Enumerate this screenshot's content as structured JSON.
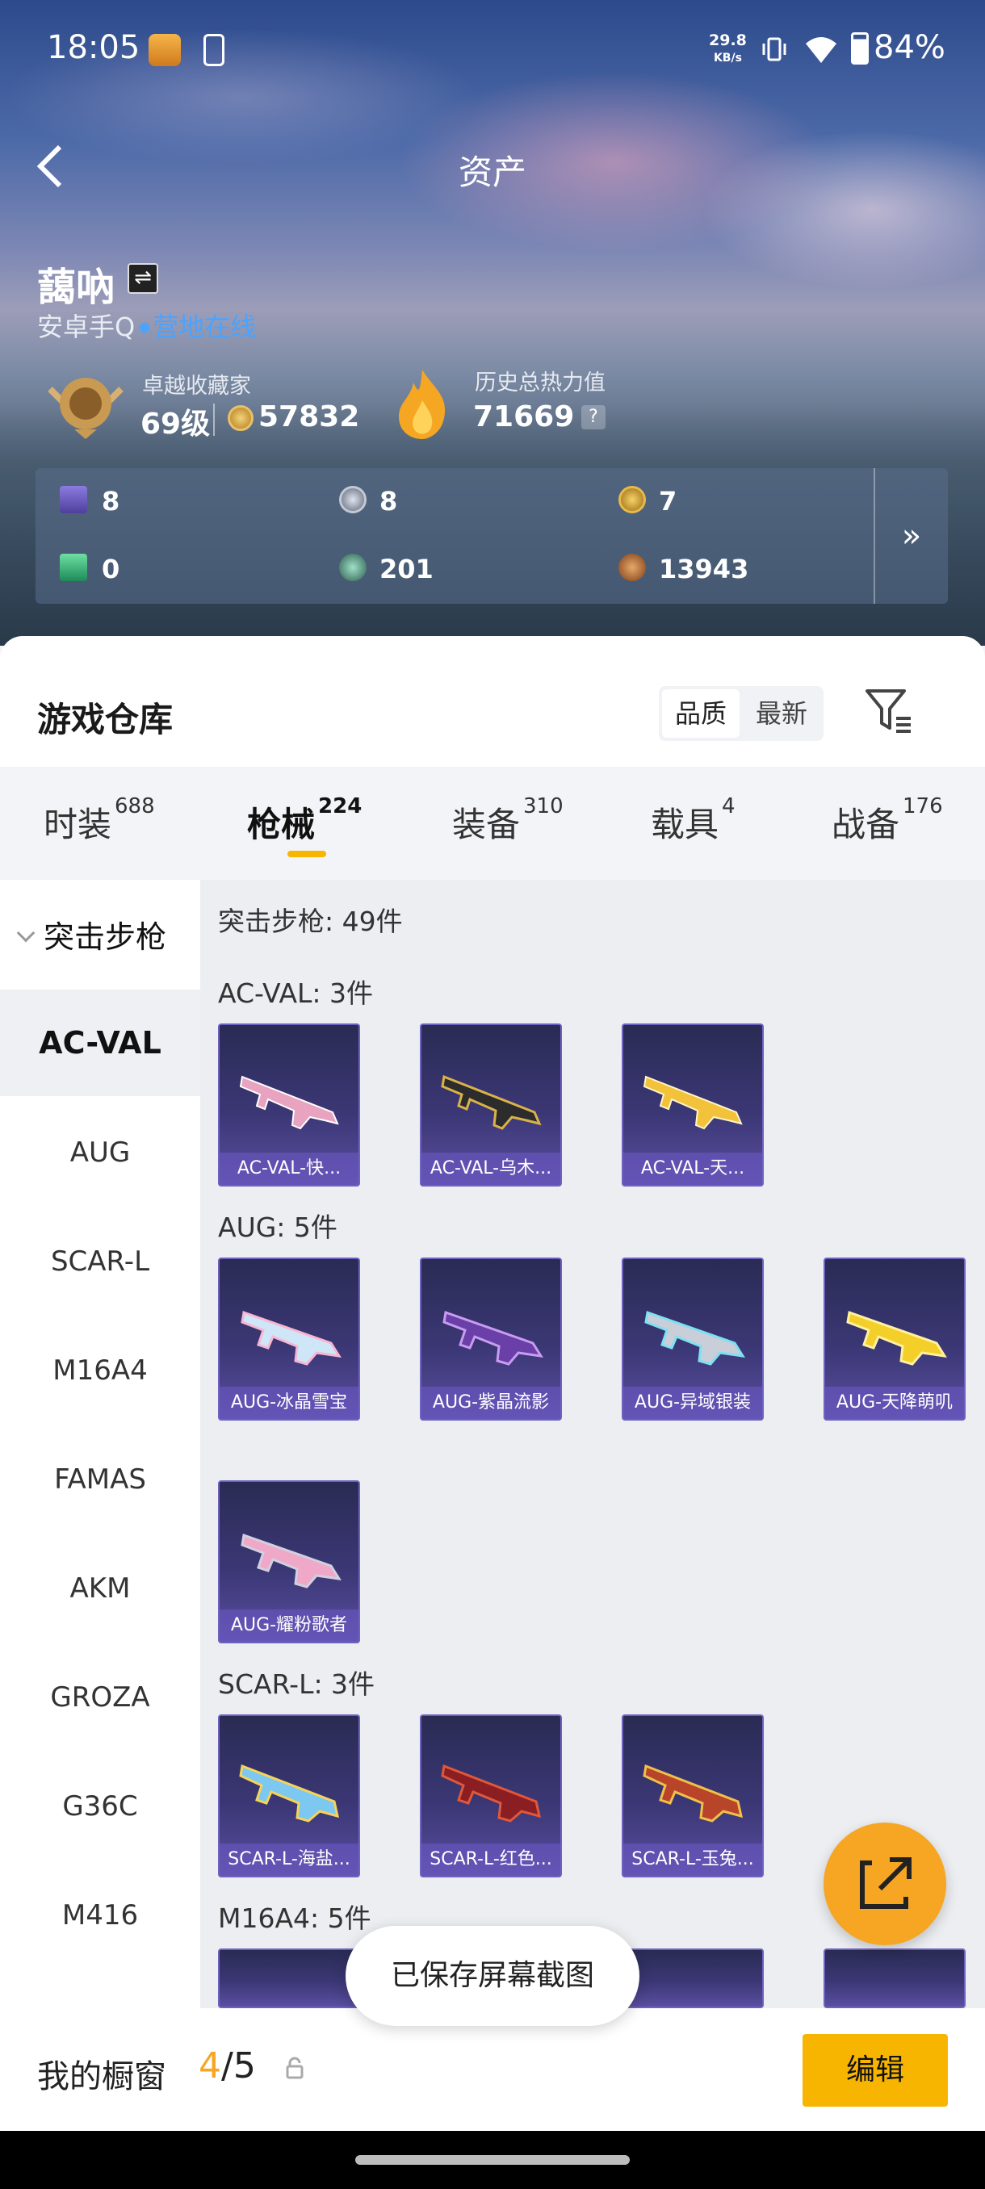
{
  "status_bar": {
    "time": "18:05",
    "speed": "29.8",
    "speed_unit": "KB/s",
    "battery": "84%"
  },
  "header": {
    "title": "资产"
  },
  "profile": {
    "name": "藹吶",
    "platform": "安卓手Q",
    "online_status": "营地在线",
    "rank_title": "卓越收藏家",
    "level": "69级",
    "coins": "57832",
    "heat_label": "历史总热力值",
    "heat_value": "71669",
    "heat_help": "?"
  },
  "currencies": [
    {
      "icon": "purple-card-icon",
      "value": "8"
    },
    {
      "icon": "silver-coin-icon",
      "value": "8"
    },
    {
      "icon": "gold-coin-icon",
      "value": "7"
    },
    {
      "icon": "green-card-icon",
      "value": "0"
    },
    {
      "icon": "green-orb-icon",
      "value": "201"
    },
    {
      "icon": "bronze-coin-icon",
      "value": "13943"
    }
  ],
  "currencies_more": "»",
  "warehouse": {
    "title": "游戏仓库",
    "sort_quality": "品质",
    "sort_newest": "最新"
  },
  "tabs": [
    {
      "label": "时装",
      "count": "688"
    },
    {
      "label": "枪械",
      "count": "224",
      "active": true
    },
    {
      "label": "装备",
      "count": "310"
    },
    {
      "label": "载具",
      "count": "4"
    },
    {
      "label": "战备",
      "count": "176"
    }
  ],
  "sidebar": {
    "category": "突击步枪",
    "items": [
      "AC-VAL",
      "AUG",
      "SCAR-L",
      "M16A4",
      "FAMAS",
      "AKM",
      "GROZA",
      "G36C",
      "M416"
    ]
  },
  "content": {
    "category_header": "突击步枪: 49件",
    "groups": [
      {
        "header": "AC-VAL: 3件",
        "items": [
          "AC-VAL-快...",
          "AC-VAL-乌木...",
          "AC-VAL-天..."
        ]
      },
      {
        "header": "AUG: 5件",
        "items": [
          "AUG-冰晶雪宝",
          "AUG-紫晶流影",
          "AUG-异域银装",
          "AUG-天降萌叽",
          "AUG-耀粉歌者"
        ]
      },
      {
        "header": "SCAR-L: 3件",
        "items": [
          "SCAR-L-海盐...",
          "SCAR-L-红色...",
          "SCAR-L-玉兔..."
        ]
      },
      {
        "header": "M16A4: 5件",
        "items": []
      }
    ]
  },
  "colors": {
    "accent": "#f7b500",
    "online": "#4aa3ff",
    "card_bg": "#3b3775"
  },
  "toast": "已保存屏幕截图",
  "showcase": {
    "label": "我的橱窗",
    "current": "4",
    "total": "/5",
    "edit_label": "编辑"
  }
}
